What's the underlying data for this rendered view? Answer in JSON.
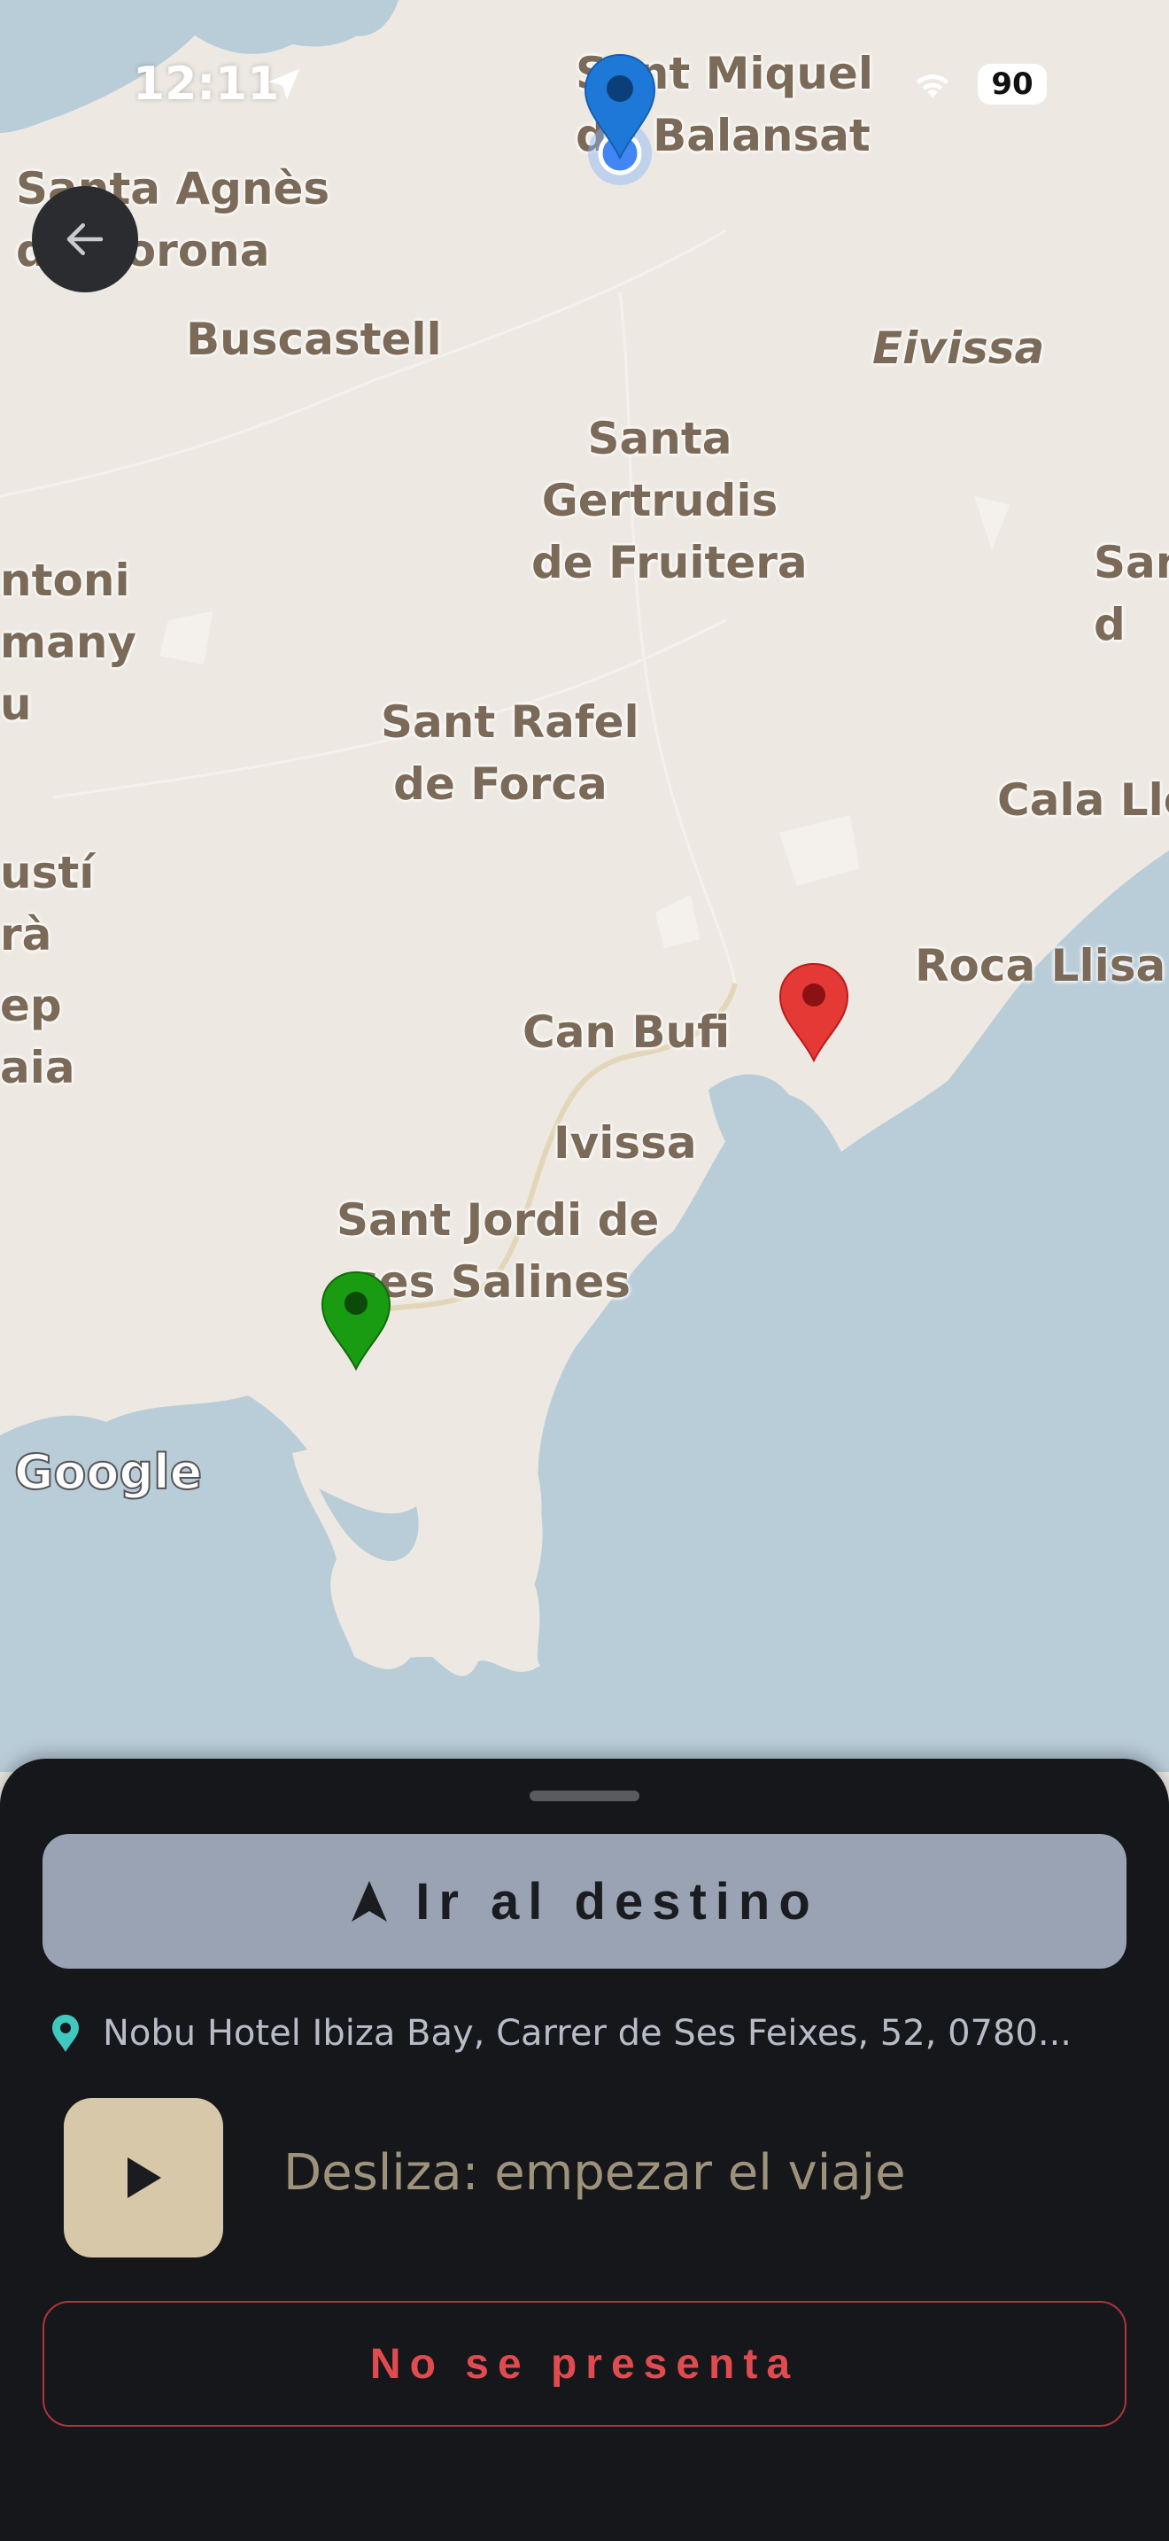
{
  "status_bar": {
    "time": "12:11",
    "battery": "90"
  },
  "map": {
    "places": {
      "sant_miquel": "Sant Miquel\nde Balansat",
      "santa_agnes": "Santa Agnès\nde Corona",
      "buscastell": "Buscastell",
      "eivissa": "Eivissa",
      "santa_gertrudis": "Santa\nGertrudis\nde Fruitera",
      "sant_antoni": "ntoni\nmany\nu",
      "sant_rafel": "Sant Rafel\nde Forca",
      "cala_llonga": "Cala Llo",
      "san_right": "San\nd",
      "agusti": "ustí\nrà",
      "josep": "ep\naia",
      "roca_llisa": "Roca Llisa",
      "can_bufi": "Can Bufi",
      "ivissa": "Ivissa",
      "sant_jordi": "Sant Jordi de\nses Salines"
    },
    "google_logo": "Google",
    "colors": {
      "land": "#ede9e2",
      "water": "#b9cdd9",
      "pin_origin": "#1a9c12",
      "pin_dest": "#e53935",
      "pin_driver": "#1976d2"
    }
  },
  "sheet": {
    "go_button": {
      "label": "Ir al destino",
      "icon": "navigation-arrow-icon"
    },
    "address": {
      "text": "Nobu Hotel Ibiza Bay, Carrer de Ses Feixes, 52, 0780...",
      "icon": "location-pin-icon",
      "icon_color": "#3fc7c0"
    },
    "slider": {
      "label": "Desliza: empezar el viaje",
      "icon": "play-icon"
    },
    "no_show_button": {
      "label": "No se presenta"
    }
  }
}
